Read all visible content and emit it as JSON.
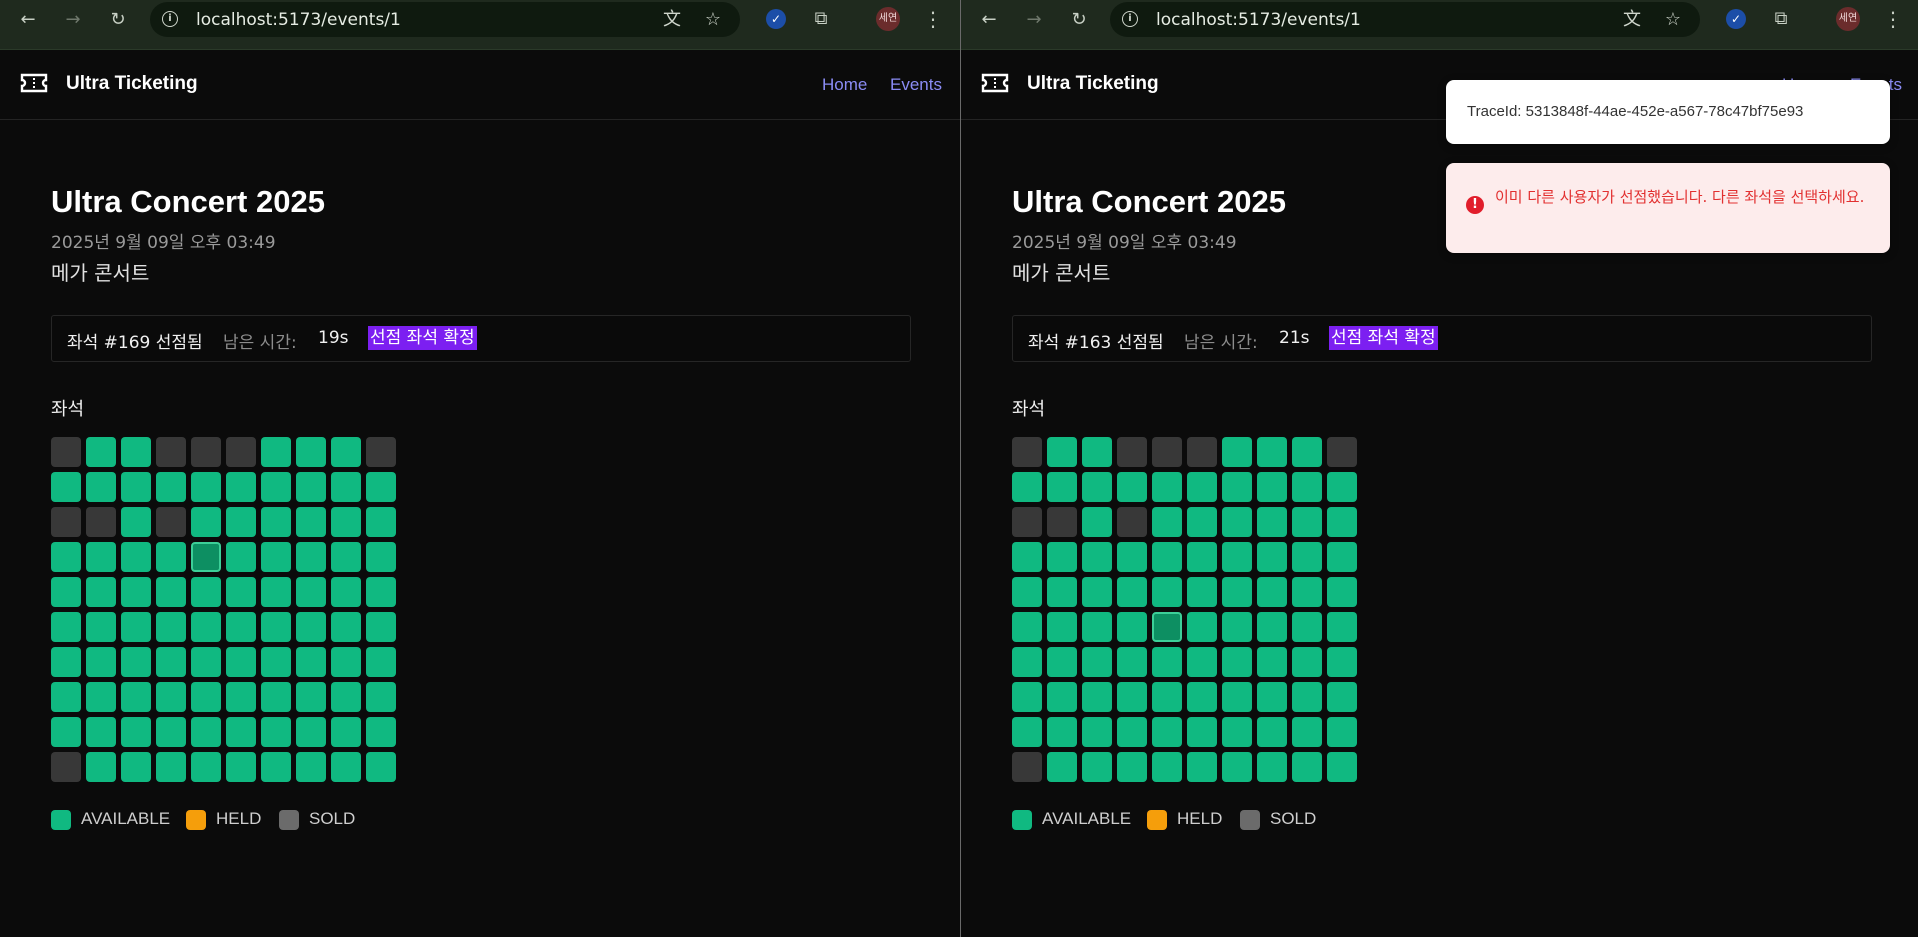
{
  "browser": {
    "url": "localhost:5173/events/1",
    "profile_initials": "세연",
    "icons": [
      "back-arrow-icon",
      "forward-arrow-icon",
      "reload-icon",
      "info-icon",
      "translate-icon",
      "star-icon",
      "extension-check-icon",
      "puzzle-icon",
      "kebab-menu-icon"
    ]
  },
  "app": {
    "brand": "Ultra Ticketing",
    "nav": {
      "home": "Home",
      "events": "Events"
    },
    "colors": {
      "accent": "#8b8cf5",
      "available": "#10b981",
      "held": "#f59e0b",
      "sold": "#6b6b6b",
      "confirm": "#7c1ff1"
    }
  },
  "event": {
    "title": "Ultra Concert 2025",
    "date": "2025년 9월 09일 오후 03:49",
    "description": "메가 콘서트"
  },
  "panes": [
    {
      "hold": {
        "seat_text": "좌석 #169 선점됨",
        "remaining_label": "남은 시간:",
        "remaining_value": "19s",
        "confirm_label": "선점 좌석 확정"
      },
      "selected_index": 34
    },
    {
      "hold": {
        "seat_text": "좌석 #163 선점됨",
        "remaining_label": "남은 시간:",
        "remaining_value": "21s",
        "confirm_label": "선점 좌석 확정"
      },
      "selected_index": 54
    }
  ],
  "seats": {
    "label": "좌석",
    "rows": 10,
    "cols": 10,
    "sold_indices": [
      0,
      3,
      4,
      5,
      9,
      20,
      21,
      23,
      90
    ]
  },
  "legend": {
    "available": "AVAILABLE",
    "held": "HELD",
    "sold": "SOLD"
  },
  "toasts": {
    "trace": "TraceId: 5313848f-44ae-452e-a567-78c47bf75e93",
    "error": "이미 다른 사용자가 선점했습니다. 다른 좌석을 선택하세요."
  }
}
